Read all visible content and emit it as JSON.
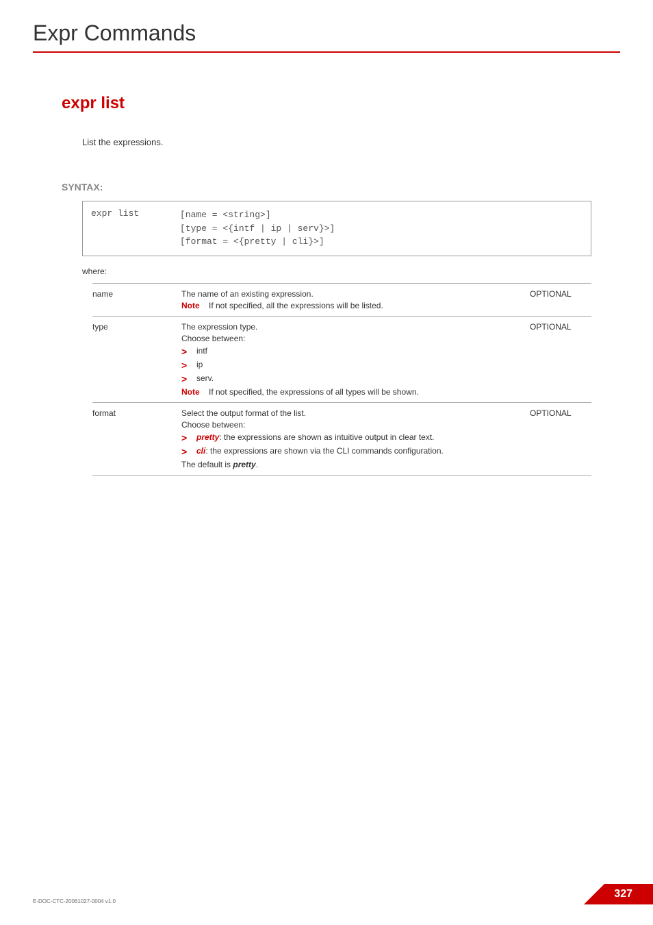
{
  "page_title": "Expr Commands",
  "section_heading": "expr list",
  "description": "List the expressions.",
  "syntax_label": "SYNTAX:",
  "syntax": {
    "command": "expr list",
    "args": [
      "[name = <string>]",
      "[type = <{intf | ip | serv}>]",
      "[format = <{pretty | cli}>]"
    ]
  },
  "where_label": "where:",
  "params": {
    "name": {
      "label": "name",
      "desc": "The name of an existing expression.",
      "note_label": "Note",
      "note_text": "If not specified, all the expressions will be listed.",
      "optional": "OPTIONAL"
    },
    "type": {
      "label": "type",
      "desc_line1": "The expression type.",
      "desc_line2": "Choose between:",
      "bullets": [
        "intf",
        "ip",
        "serv."
      ],
      "note_label": "Note",
      "note_text": "If not specified, the expressions of all types will be shown.",
      "optional": "OPTIONAL"
    },
    "format": {
      "label": "format",
      "desc_line1": "Select the output format of the list.",
      "desc_line2": "Choose between:",
      "bullet1_bold": "pretty",
      "bullet1_rest": ": the expressions are shown as intuitive output in clear text.",
      "bullet2_bold": "cli",
      "bullet2_rest": ": the expressions are shown via the CLI commands configuration.",
      "default_text_pre": "The default is ",
      "default_text_bold": "pretty",
      "default_text_post": ".",
      "optional": "OPTIONAL"
    }
  },
  "footer_id": "E-DOC-CTC-20061027-0004 v1.0",
  "page_number": "327"
}
